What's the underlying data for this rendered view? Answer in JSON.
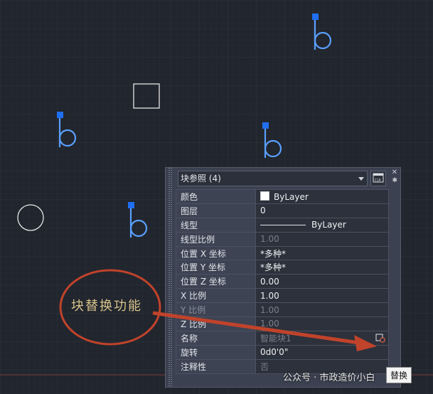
{
  "palette": {
    "view_ribbon_text": "#e2e5ea",
    "block_glyph": "#5aa0ff",
    "grip": "#1f6ff0",
    "callout": "#c0432b"
  },
  "panel": {
    "header_title": "块参照 (4)",
    "rows": [
      {
        "key": "颜色",
        "value": "ByLayer",
        "swatch": "#ffffff"
      },
      {
        "key": "图层",
        "value": "0"
      },
      {
        "key": "线型",
        "value": "ByLayer",
        "linetype": true
      },
      {
        "key": "线型比例",
        "value": "1.00",
        "dim": true
      },
      {
        "key": "位置 X 坐标",
        "value": "*多种*"
      },
      {
        "key": "位置 Y 坐标",
        "value": "*多种*"
      },
      {
        "key": "位置 Z 坐标",
        "value": "0.00"
      },
      {
        "key": "X 比例",
        "value": "1.00"
      },
      {
        "key": "Y 比例",
        "value": "1.00",
        "dim": true,
        "keydim": true
      },
      {
        "key": "Z 比例",
        "value": "1.00",
        "dim": true
      },
      {
        "key": "名称",
        "value": "智能块1",
        "dim": true,
        "icon": "block-replace-icon"
      },
      {
        "key": "旋转",
        "value": "0d0'0\""
      },
      {
        "key": "注释性",
        "value": "否",
        "dim": true
      }
    ]
  },
  "callout": {
    "text": "块替换功能"
  },
  "watermark": {
    "text": "公众号 · 市政造价小白"
  },
  "tooltip": {
    "text": "替换"
  }
}
